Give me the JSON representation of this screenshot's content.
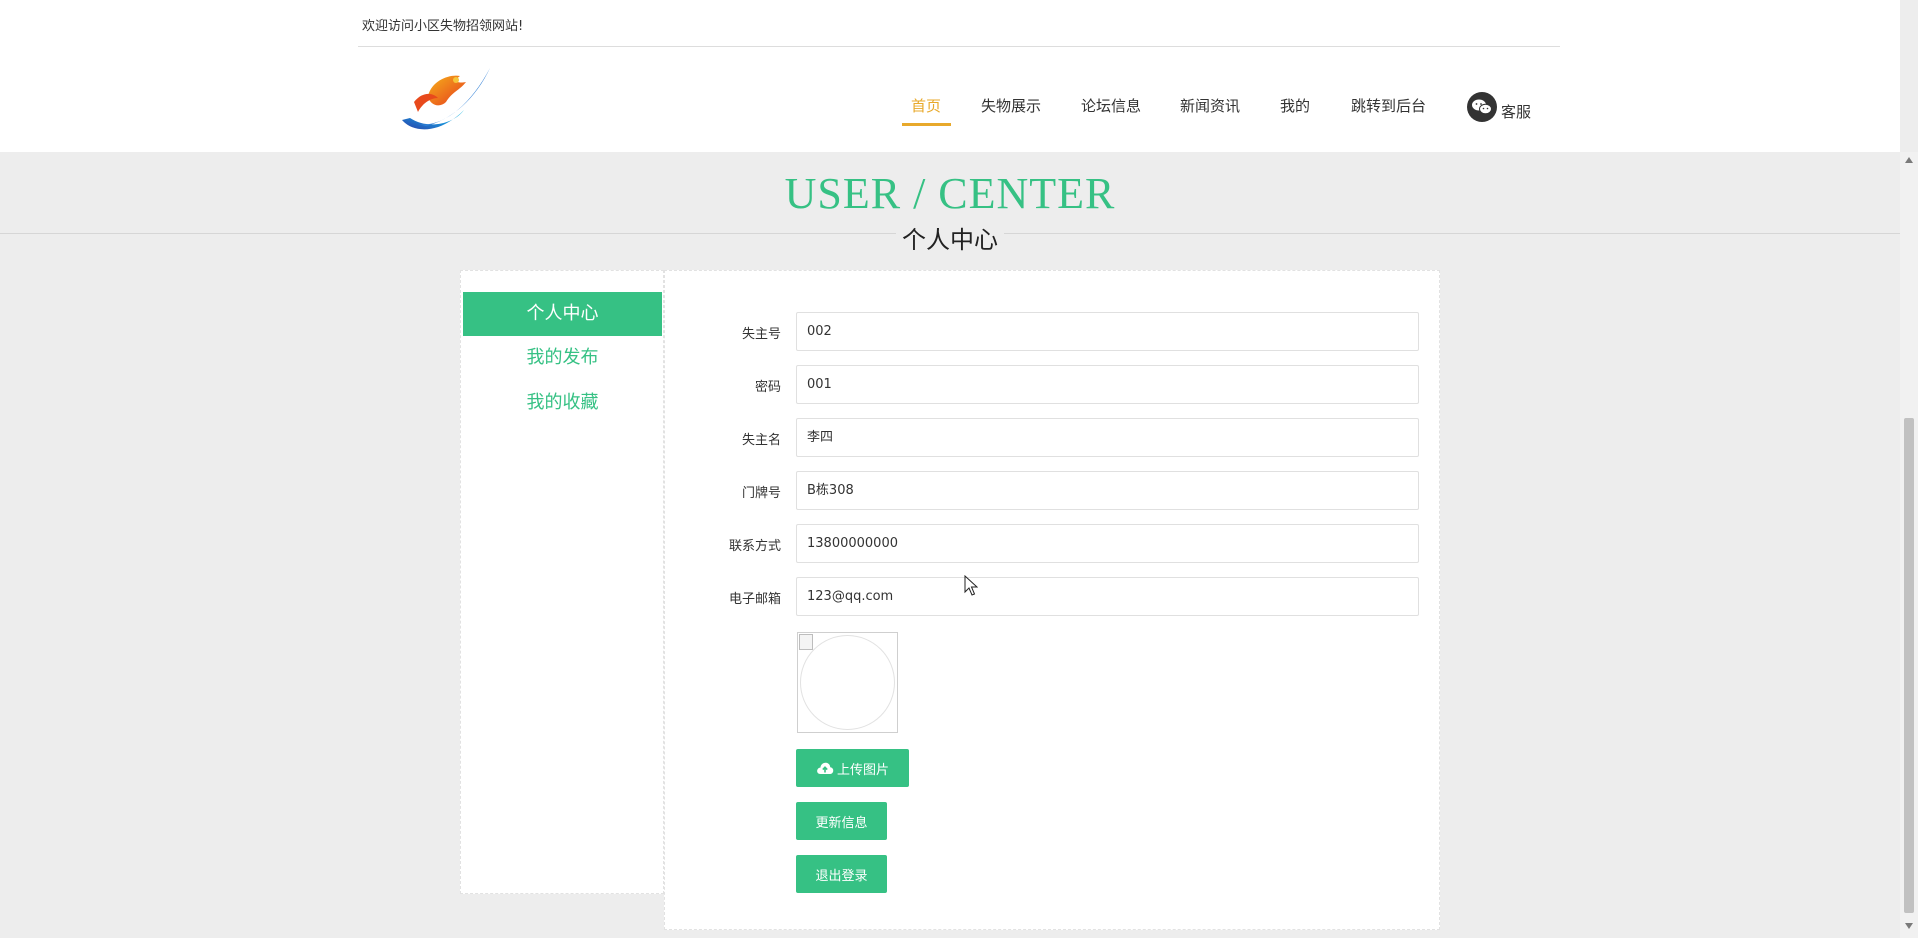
{
  "header": {
    "welcome": "欢迎访问小区失物招领网站!",
    "nav": [
      "首页",
      "失物展示",
      "论坛信息",
      "新闻资讯",
      "我的",
      "跳转到后台"
    ],
    "active_nav": "首页",
    "customer_service": "客服"
  },
  "page": {
    "title_en": "USER / CENTER",
    "title_cn": "个人中心"
  },
  "sidebar": {
    "items": [
      "个人中心",
      "我的发布",
      "我的收藏"
    ],
    "active": "个人中心"
  },
  "form": {
    "fields": [
      {
        "label": "失主号",
        "value": "002"
      },
      {
        "label": "密码",
        "value": "001"
      },
      {
        "label": "失主名",
        "value": "李四"
      },
      {
        "label": "门牌号",
        "value": "B栋308"
      },
      {
        "label": "联系方式",
        "value": "13800000000"
      },
      {
        "label": "电子邮箱",
        "value": "123@qq.com"
      }
    ],
    "upload_label": "上传图片",
    "update_label": "更新信息",
    "logout_label": "退出登录"
  },
  "colors": {
    "accent": "#36c184",
    "nav_active": "#e8a92b"
  },
  "icons": [
    "logo",
    "wechat-icon",
    "cloud-upload-icon"
  ]
}
